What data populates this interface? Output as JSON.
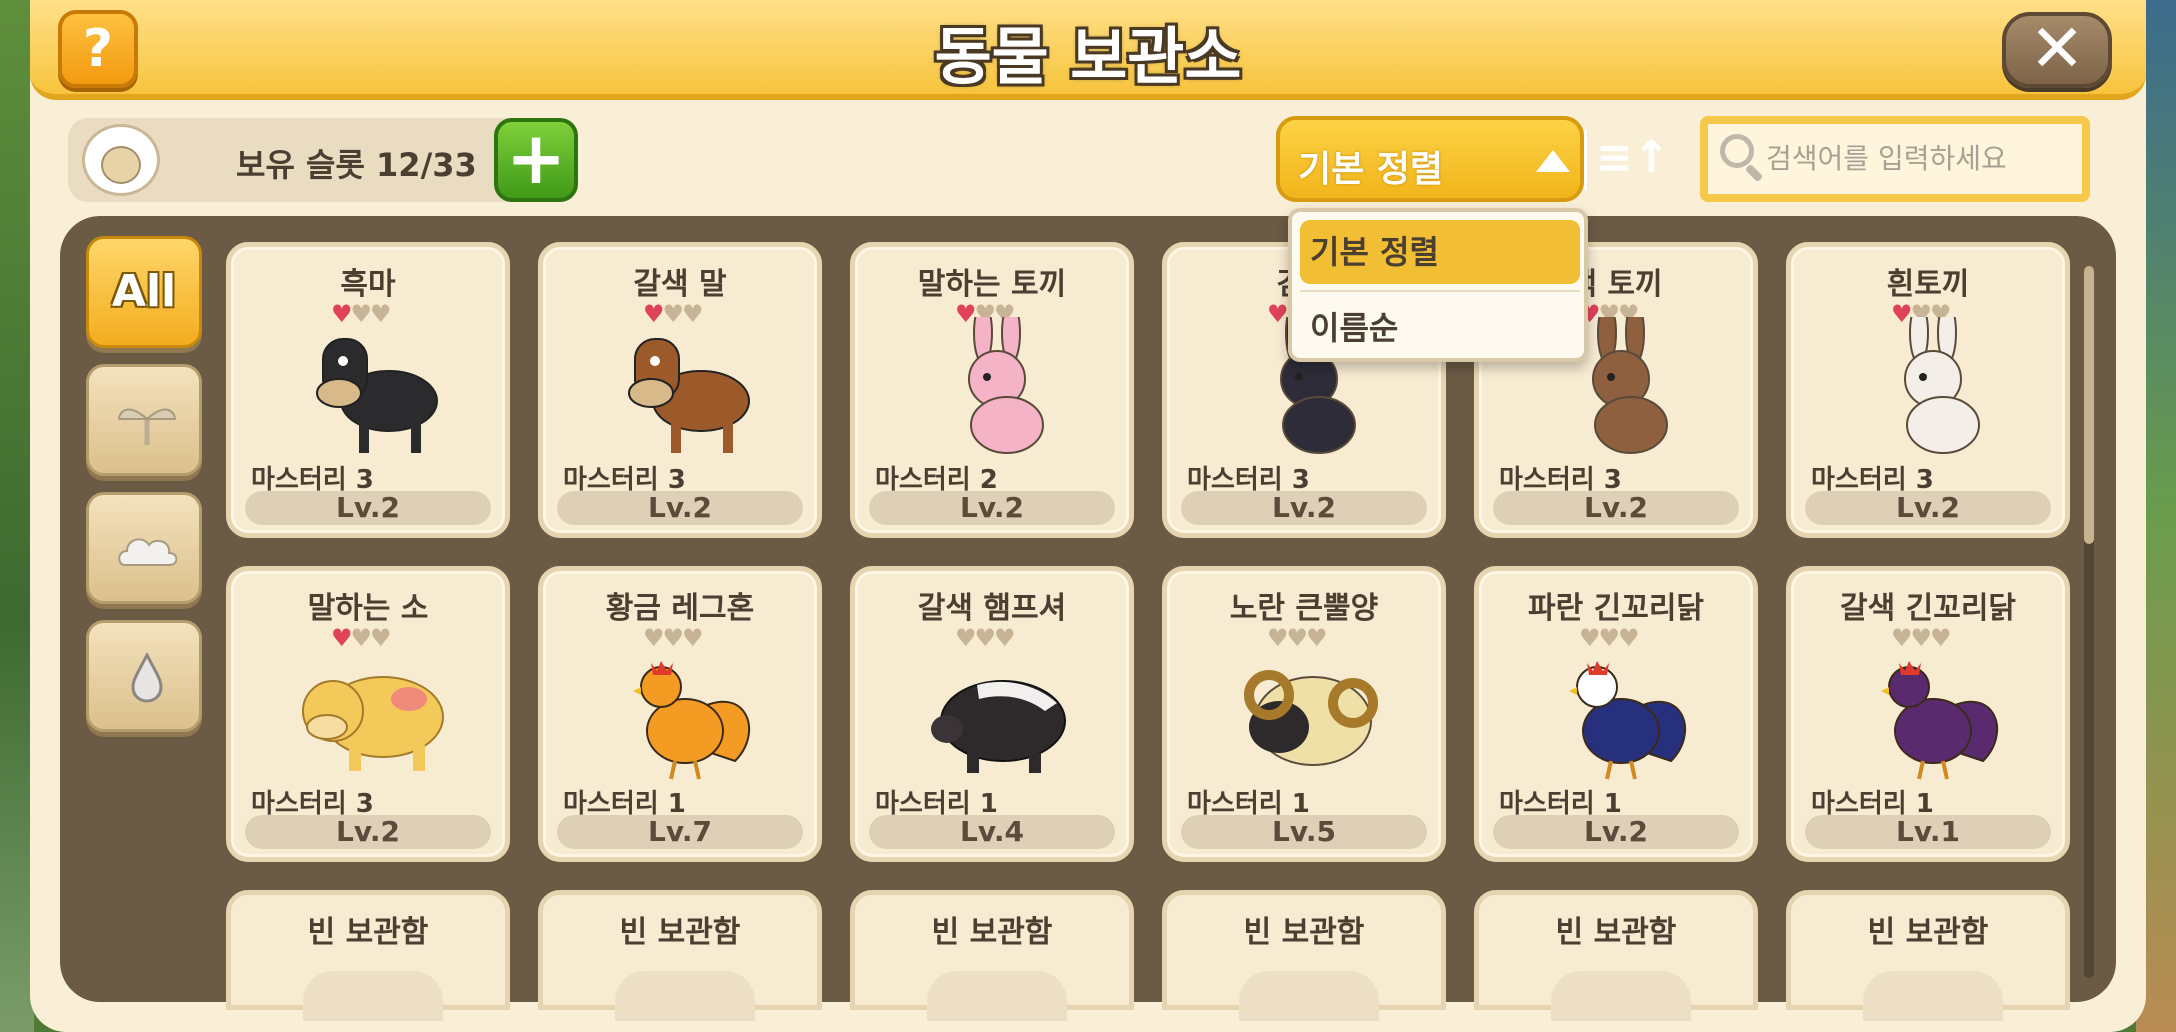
{
  "header": {
    "title": "동물 보관소",
    "help_label": "?",
    "close_label": "✕"
  },
  "toolbar": {
    "slot_text": "보유 슬롯 12/33",
    "add_label": "+",
    "sort_label": "기본 정렬",
    "order_label": "≡↑",
    "search_placeholder": "검색어를 입력하세요"
  },
  "dropdown": {
    "options": [
      "기본 정렬",
      "이름순"
    ],
    "selected": "기본 정렬"
  },
  "categories": [
    {
      "label": "All",
      "icon": "all-icon"
    },
    {
      "label": "",
      "icon": "sprout-icon"
    },
    {
      "label": "",
      "icon": "cloud-icon"
    },
    {
      "label": "",
      "icon": "water-drop-icon"
    }
  ],
  "animals": [
    {
      "name": "흑마",
      "mastery": "마스터리 3",
      "level": "Lv.2",
      "hearts_filled": 1,
      "hearts_total": 3,
      "icon": "black-horse-icon",
      "color": "#2b2a2c"
    },
    {
      "name": "갈색 말",
      "mastery": "마스터리 3",
      "level": "Lv.2",
      "hearts_filled": 1,
      "hearts_total": 3,
      "icon": "brown-horse-icon",
      "color": "#9c5a2b"
    },
    {
      "name": "말하는 토끼",
      "mastery": "마스터리 2",
      "level": "Lv.2",
      "hearts_filled": 1,
      "hearts_total": 3,
      "icon": "pink-rabbit-icon",
      "color": "#f4b3c6"
    },
    {
      "name": "검은",
      "mastery": "마스터리 3",
      "level": "Lv.2",
      "hearts_filled": 1,
      "hearts_total": 3,
      "icon": "black-rabbit-icon",
      "color": "#2e2c38"
    },
    {
      "name": "색 토끼",
      "mastery": "마스터리 3",
      "level": "Lv.2",
      "hearts_filled": 1,
      "hearts_total": 3,
      "icon": "brown-rabbit-icon",
      "color": "#8e6040"
    },
    {
      "name": "흰토끼",
      "mastery": "마스터리 3",
      "level": "Lv.2",
      "hearts_filled": 1,
      "hearts_total": 3,
      "icon": "white-rabbit-icon",
      "color": "#f3eee8"
    },
    {
      "name": "말하는 소",
      "mastery": "마스터리 3",
      "level": "Lv.2",
      "hearts_filled": 1,
      "hearts_total": 3,
      "icon": "yellow-cow-icon",
      "color": "#f3c95a"
    },
    {
      "name": "황금 레그혼",
      "mastery": "마스터리 1",
      "level": "Lv.7",
      "hearts_filled": 0,
      "hearts_total": 3,
      "icon": "golden-chicken-icon",
      "color": "#f39b22"
    },
    {
      "name": "갈색 햄프셔",
      "mastery": "마스터리 1",
      "level": "Lv.4",
      "hearts_filled": 0,
      "hearts_total": 3,
      "icon": "black-pig-icon",
      "color": "#2e2a2c"
    },
    {
      "name": "노란 큰뿔양",
      "mastery": "마스터리 1",
      "level": "Lv.5",
      "hearts_filled": 0,
      "hearts_total": 3,
      "icon": "ram-icon",
      "color": "#efe0a8"
    },
    {
      "name": "파란 긴꼬리닭",
      "mastery": "마스터리 1",
      "level": "Lv.2",
      "hearts_filled": 0,
      "hearts_total": 3,
      "icon": "blue-rooster-icon",
      "color": "#27307c"
    },
    {
      "name": "갈색 긴꼬리닭",
      "mastery": "마스터리 1",
      "level": "Lv.1",
      "hearts_filled": 0,
      "hearts_total": 3,
      "icon": "purple-rooster-icon",
      "color": "#5a2a6e"
    }
  ],
  "empty_slots": [
    "빈 보관함",
    "빈 보관함",
    "빈 보관함",
    "빈 보관함",
    "빈 보관함",
    "빈 보관함"
  ]
}
